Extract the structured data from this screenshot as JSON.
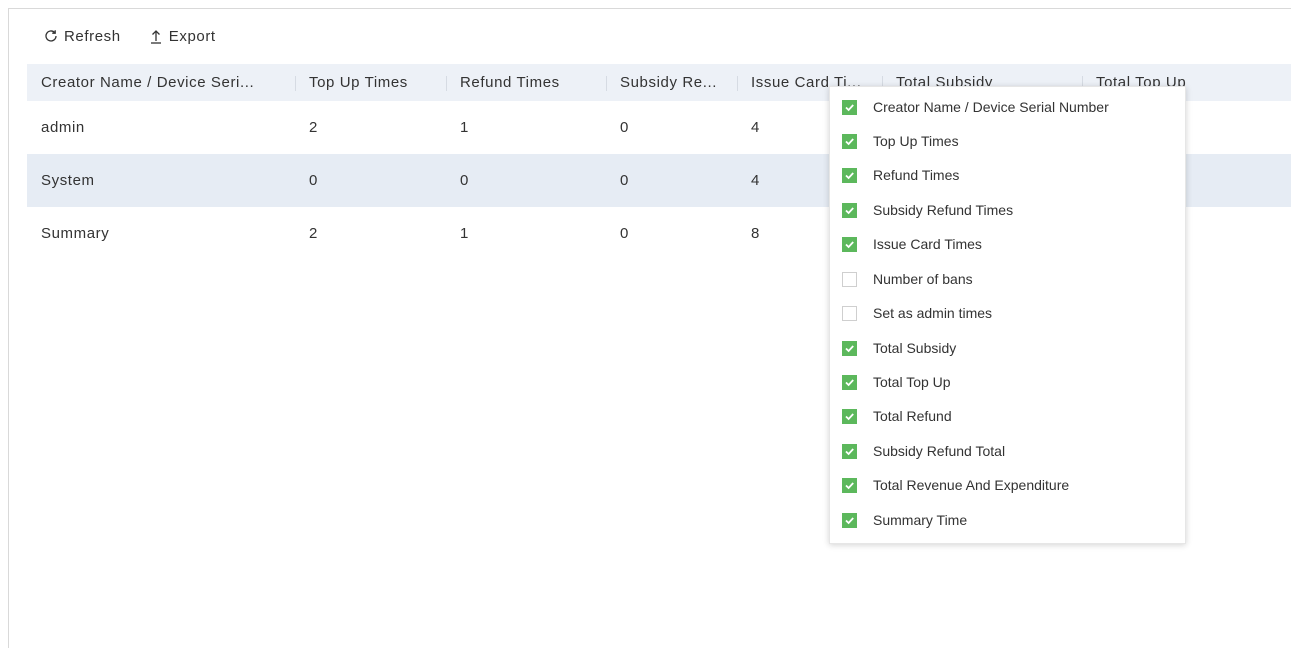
{
  "toolbar": {
    "refresh_label": "Refresh",
    "export_label": "Export"
  },
  "table": {
    "columns": [
      "Creator Name / Device Seri...",
      "Top Up Times",
      "Refund Times",
      "Subsidy Re...",
      "Issue Card Ti...",
      "Total Subsidy",
      "Total Top Up"
    ],
    "rows": [
      [
        "admin",
        "2",
        "1",
        "0",
        "4",
        "",
        ""
      ],
      [
        "System",
        "0",
        "0",
        "0",
        "4",
        "",
        ""
      ],
      [
        "Summary",
        "2",
        "1",
        "0",
        "8",
        "",
        ""
      ]
    ]
  },
  "column_picker": {
    "options": [
      {
        "label": "Creator Name / Device Serial Number",
        "checked": true
      },
      {
        "label": "Top Up Times",
        "checked": true
      },
      {
        "label": "Refund Times",
        "checked": true
      },
      {
        "label": "Subsidy Refund Times",
        "checked": true
      },
      {
        "label": "Issue Card Times",
        "checked": true
      },
      {
        "label": "Number of bans",
        "checked": false
      },
      {
        "label": "Set as admin times",
        "checked": false
      },
      {
        "label": "Total Subsidy",
        "checked": true
      },
      {
        "label": "Total Top Up",
        "checked": true
      },
      {
        "label": "Total Refund",
        "checked": true
      },
      {
        "label": "Subsidy Refund Total",
        "checked": true
      },
      {
        "label": "Total Revenue And Expenditure",
        "checked": true
      },
      {
        "label": "Summary Time",
        "checked": true
      }
    ]
  },
  "colors": {
    "check_green": "#5cb85c",
    "header_bg": "#edf1f7",
    "alt_row_bg": "#e6ecf4"
  },
  "icons": {
    "refresh": "refresh-icon",
    "export": "export-icon",
    "check": "check-icon"
  }
}
